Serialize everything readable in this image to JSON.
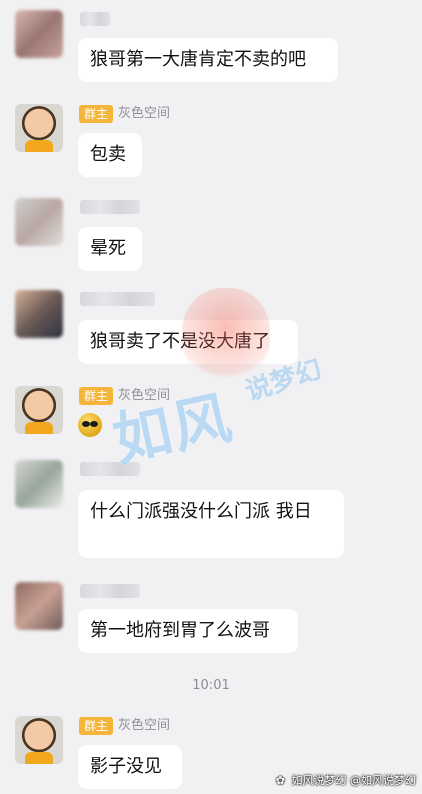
{
  "messages": [
    {
      "sender": "",
      "text": "狼哥第一大唐肯定不卖的吧"
    },
    {
      "sender": "灰色空间",
      "badge": "群主",
      "text": "包卖"
    },
    {
      "sender": "",
      "text": "晕死"
    },
    {
      "sender": "",
      "text": "狼哥卖了不是没大唐了"
    },
    {
      "sender": "灰色空间",
      "badge": "群主",
      "emoji": "sunglasses-face"
    },
    {
      "sender": "",
      "text": "什么门派强没什么门派 我日"
    },
    {
      "sender": "",
      "text": "第一地府到胃了么波哥"
    },
    {
      "sender": "灰色空间",
      "badge": "群主",
      "text": "影子没见"
    }
  ],
  "time": "10:01",
  "watermark": {
    "big": "如风",
    "small": "说梦幻",
    "corner": "如风说梦幻",
    "corner_handle": "@如风说梦幻"
  },
  "colors": {
    "badge": "#f5b43a",
    "bubble": "#ffffff",
    "bg": "#f1f1f3"
  }
}
